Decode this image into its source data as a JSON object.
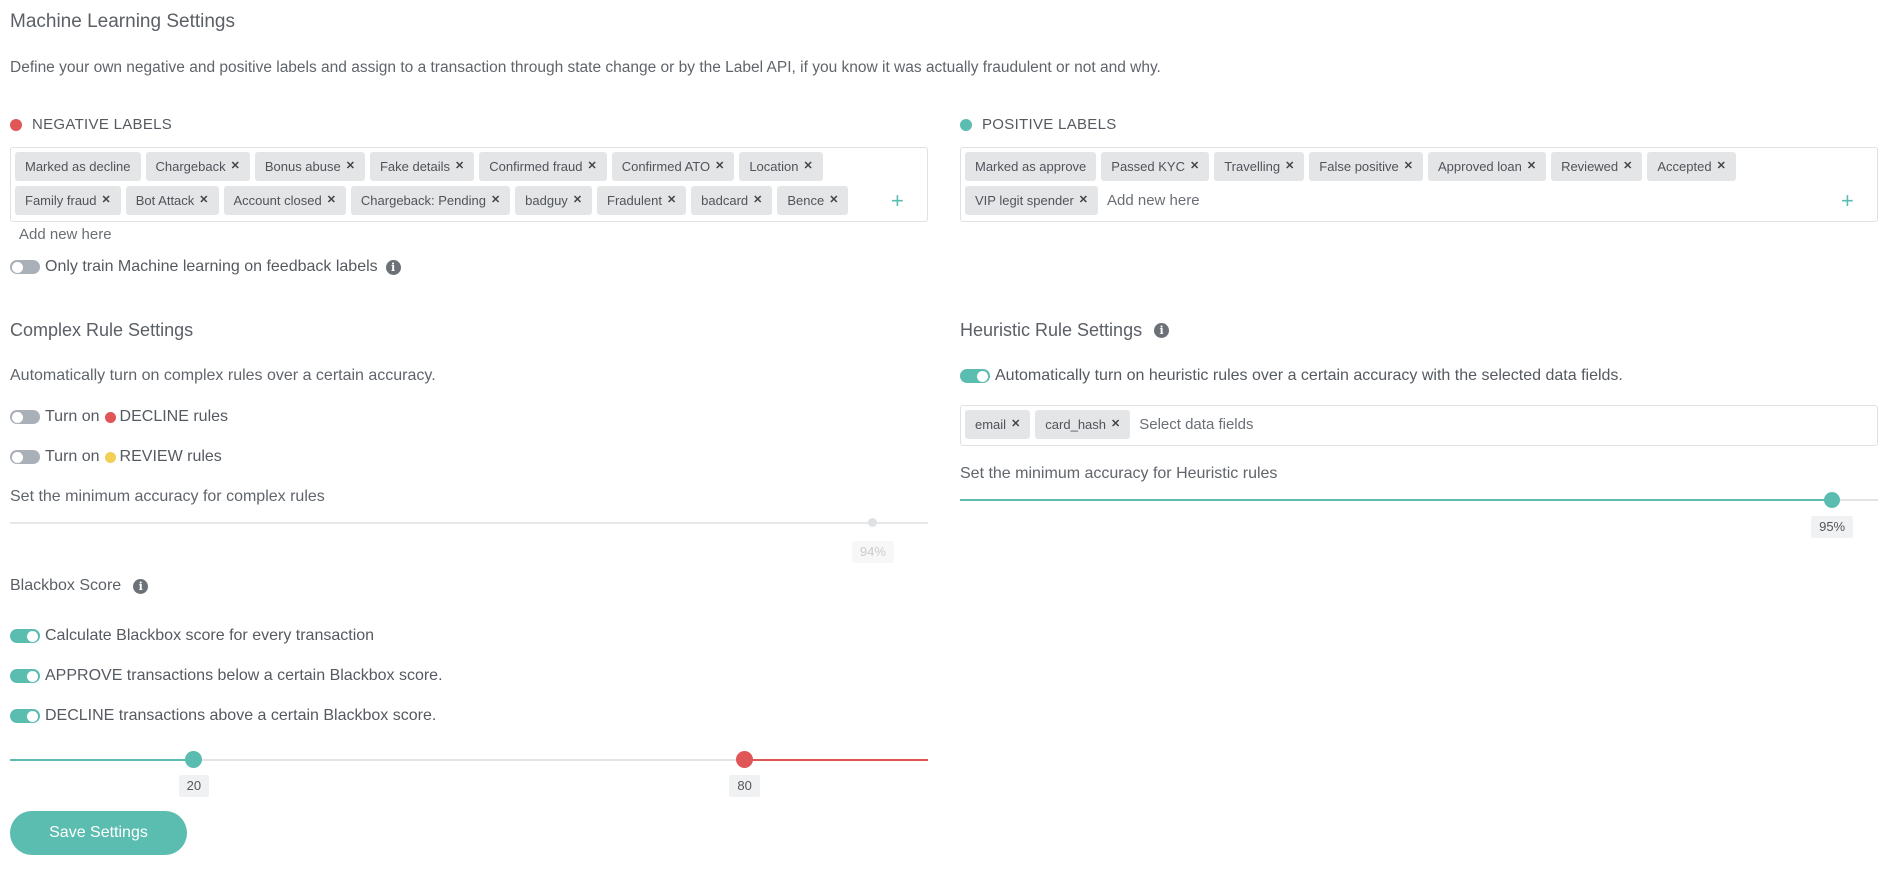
{
  "ml": {
    "title": "Machine Learning Settings",
    "description": "Define your own negative and positive labels and assign to a transaction through state change or by the Label API, if you know it was actually fraudulent or not and why."
  },
  "negative": {
    "heading": "NEGATIVE LABELS",
    "labels": [
      {
        "text": "Marked as decline",
        "removable": false
      },
      {
        "text": "Chargeback",
        "removable": true
      },
      {
        "text": "Bonus abuse",
        "removable": true
      },
      {
        "text": "Fake details",
        "removable": true
      },
      {
        "text": "Confirmed fraud",
        "removable": true
      },
      {
        "text": "Confirmed ATO",
        "removable": true
      },
      {
        "text": "Location",
        "removable": true
      },
      {
        "text": "Family fraud",
        "removable": true
      },
      {
        "text": "Bot Attack",
        "removable": true
      },
      {
        "text": "Account closed",
        "removable": true
      },
      {
        "text": "Chargeback: Pending",
        "removable": true
      },
      {
        "text": "badguy",
        "removable": true
      },
      {
        "text": "Fradulent",
        "removable": true
      },
      {
        "text": "badcard",
        "removable": true
      },
      {
        "text": "Bence",
        "removable": true
      }
    ],
    "placeholder": "Add new here"
  },
  "positive": {
    "heading": "POSITIVE LABELS",
    "labels": [
      {
        "text": "Marked as approve",
        "removable": false
      },
      {
        "text": "Passed KYC",
        "removable": true
      },
      {
        "text": "Travelling",
        "removable": true
      },
      {
        "text": "False positive",
        "removable": true
      },
      {
        "text": "Approved loan",
        "removable": true
      },
      {
        "text": "Reviewed",
        "removable": true
      },
      {
        "text": "Accepted",
        "removable": true
      },
      {
        "text": "VIP legit spender",
        "removable": true
      }
    ],
    "placeholder": "Add new here"
  },
  "feedback_toggle": {
    "label": "Only train Machine learning on feedback labels",
    "on": false
  },
  "complex": {
    "title": "Complex Rule Settings",
    "description": "Automatically turn on complex rules over a certain accuracy.",
    "decline": {
      "prefix": "Turn on",
      "label": "DECLINE rules",
      "on": false
    },
    "review": {
      "prefix": "Turn on",
      "label": "REVIEW rules",
      "on": false
    },
    "accuracy_label": "Set the minimum accuracy for complex rules",
    "accuracy_value": 94,
    "accuracy_text": "94%"
  },
  "heuristic": {
    "title": "Heuristic Rule Settings",
    "auto": {
      "label": "Automatically turn on heuristic rules over a certain accuracy with the selected data fields.",
      "on": true
    },
    "fields": [
      "email",
      "card_hash"
    ],
    "fields_placeholder": "Select data fields",
    "accuracy_label": "Set the minimum accuracy for Heuristic rules",
    "accuracy_value": 95,
    "accuracy_text": "95%"
  },
  "blackbox": {
    "title": "Blackbox Score",
    "calc": {
      "label": "Calculate Blackbox score for every transaction",
      "on": true
    },
    "approve": {
      "label": "APPROVE transactions below a certain Blackbox score.",
      "on": true
    },
    "decline": {
      "label": "DECLINE transactions above a certain Blackbox score.",
      "on": true
    },
    "approve_value": 20,
    "decline_value": 80,
    "approve_text": "20",
    "decline_text": "80"
  },
  "save_label": "Save Settings",
  "colors": {
    "accent": "#5bbcb0",
    "danger": "#e05555",
    "warning": "#f2cf55"
  }
}
